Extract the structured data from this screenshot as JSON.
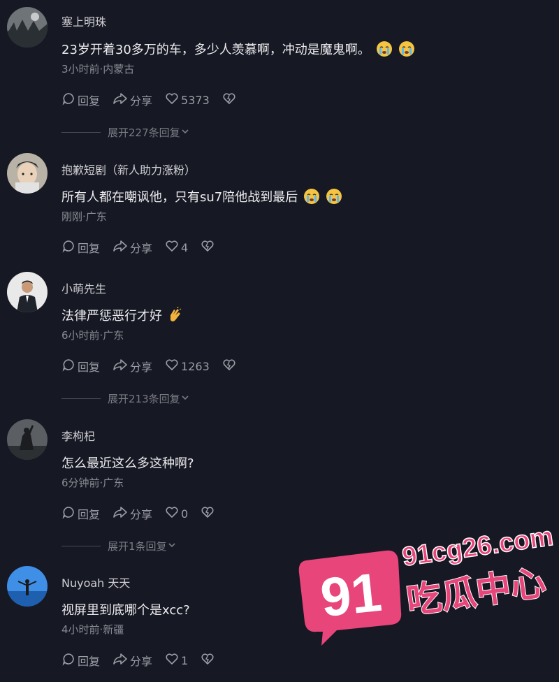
{
  "comments": [
    {
      "user": "塞上明珠",
      "text": "23岁开着30多万的车，多少人羡慕啊，冲动是魔鬼啊。",
      "emoji_count": 2,
      "meta": "3小时前·内蒙古",
      "reply": "回复",
      "share": "分享",
      "likes": "5373",
      "expand": "展开227条回复"
    },
    {
      "user": "抱歉短剧（新人助力涨粉）",
      "text": "所有人都在嘲讽他，只有su7陪他战到最后",
      "emoji_count": 2,
      "meta": "刚刚·广东",
      "reply": "回复",
      "share": "分享",
      "likes": "4",
      "expand": ""
    },
    {
      "user": "小萌先生",
      "text": "法律严惩恶行才好",
      "emoji_count": 1,
      "meta": "6小时前·广东",
      "reply": "回复",
      "share": "分享",
      "likes": "1263",
      "expand": "展开213条回复"
    },
    {
      "user": "李枸杞",
      "text": "怎么最近这么多这种啊?",
      "emoji_count": 0,
      "meta": "6分钟前·广东",
      "reply": "回复",
      "share": "分享",
      "likes": "0",
      "expand": "展开1条回复"
    },
    {
      "user": "Nuyoah 天天",
      "text": "视屏里到底哪个是xcc?",
      "emoji_count": 0,
      "meta": "4小时前·新疆",
      "reply": "回复",
      "share": "分享",
      "likes": "1",
      "expand": ""
    }
  ],
  "icons": {
    "reply": "comment-bubble-icon",
    "share": "share-arrow-icon",
    "like": "heart-icon",
    "dislike": "broken-heart-icon",
    "expand": "chevron-down-icon",
    "emoji_cry": "crying-face-emoji",
    "emoji_hands": "clapping-hands-emoji"
  },
  "watermark": {
    "number": "91",
    "site": "91cg26.com",
    "name": "吃瓜中心",
    "color": "#e8457a"
  }
}
